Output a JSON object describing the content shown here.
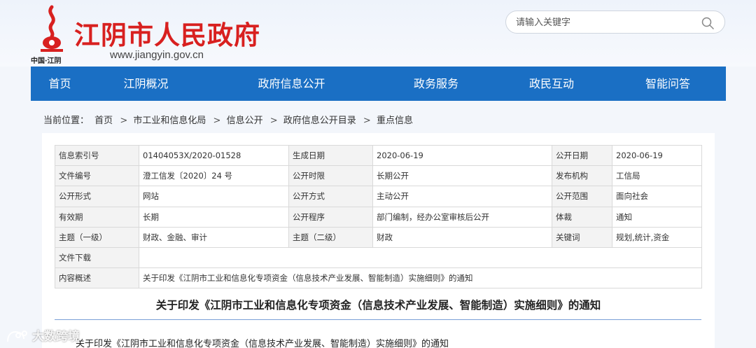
{
  "header": {
    "site_name": "江阴市人民政府",
    "url": "www.jiangyin.gov.cn",
    "origin": "中国·江阴",
    "logo_icon": "jiangyin-emblem-icon",
    "brand_color": "#d8201f"
  },
  "search": {
    "placeholder": "请输入关键字",
    "value": "",
    "icon": "search-icon"
  },
  "nav": {
    "color": "#1a6fc4",
    "items": [
      {
        "label": "首页"
      },
      {
        "label": "江阴概况"
      },
      {
        "label": "政府信息公开"
      },
      {
        "label": "政务服务"
      },
      {
        "label": "政民互动"
      },
      {
        "label": "智能问答"
      }
    ]
  },
  "breadcrumb": {
    "prefix": "当前位置：",
    "items": [
      {
        "label": "首页"
      },
      {
        "label": "市工业和信息化局"
      },
      {
        "label": "信息公开"
      },
      {
        "label": "政府信息公开目录"
      },
      {
        "label": "重点信息"
      }
    ],
    "separator": ">"
  },
  "meta_table": {
    "rows": [
      [
        {
          "k": "信息索引号",
          "v": "01404053X/2020-01528"
        },
        {
          "k": "生成日期",
          "v": "2020-06-19"
        },
        {
          "k": "公开日期",
          "v": "2020-06-19"
        }
      ],
      [
        {
          "k": "文件编号",
          "v": "澄工信发〔2020〕24 号"
        },
        {
          "k": "公开时限",
          "v": "长期公开"
        },
        {
          "k": "发布机构",
          "v": "工信局"
        }
      ],
      [
        {
          "k": "公开形式",
          "v": "网站"
        },
        {
          "k": "公开方式",
          "v": "主动公开"
        },
        {
          "k": "公开范围",
          "v": "面向社会"
        }
      ],
      [
        {
          "k": "有效期",
          "v": "长期"
        },
        {
          "k": "公开程序",
          "v": "部门编制，经办公室审核后公开"
        },
        {
          "k": "体裁",
          "v": "通知"
        }
      ],
      [
        {
          "k": "主题（一级）",
          "v": "财政、金融、审计"
        },
        {
          "k": "主题（二级）",
          "v": "财政"
        },
        {
          "k": "关键词",
          "v": "规划,统计,资金"
        }
      ]
    ],
    "download": {
      "k": "文件下载",
      "v": ""
    },
    "summary": {
      "k": "内容概述",
      "v": "关于印发《江阴市工业和信息化专项资金（信息技术产业发展、智能制造）实施细则》的通知"
    }
  },
  "document": {
    "title": "关于印发《江阴市工业和信息化专项资金（信息技术产业发展、智能制造）实施细则》的通知",
    "body_first_line": "关于印发《江阴市工业和信息化专项资金（信息技术产业发展、智能制造）实施细则》的通知"
  },
  "watermark": {
    "text": "大数跨境",
    "icon": "cat-logo-icon"
  }
}
